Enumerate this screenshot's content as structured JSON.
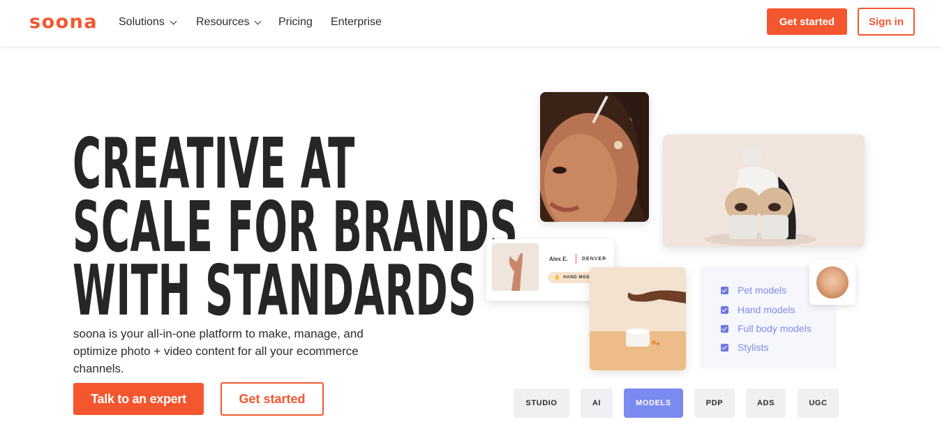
{
  "brand": {
    "logo": "soona",
    "accent": "#f4562f"
  },
  "nav": {
    "items": [
      {
        "label": "Solutions",
        "dropdown": true
      },
      {
        "label": "Resources",
        "dropdown": true
      },
      {
        "label": "Pricing",
        "dropdown": false
      },
      {
        "label": "Enterprise",
        "dropdown": false
      }
    ],
    "get_started": "Get started",
    "sign_in": "Sign in"
  },
  "hero": {
    "headline": [
      "CREATIVE AT",
      "SCALE FOR BRANDS",
      "WITH STANDARDS"
    ],
    "subtext": "soona is your all-in-one platform to make, manage, and optimize photo + video content for all your ecommerce channels.",
    "cta_primary": "Talk to an expert",
    "cta_secondary": "Get started"
  },
  "model_card": {
    "name": "Alex E.",
    "city": "DENVER",
    "tag": "HAND MODEL"
  },
  "models_list": {
    "items": [
      "Pet models",
      "Hand models",
      "Full body models",
      "Stylists"
    ],
    "color": "#7f8ae6"
  },
  "tabs": {
    "items": [
      "STUDIO",
      "AI",
      "MODELS",
      "PDP",
      "ADS",
      "UGC"
    ],
    "active": "MODELS",
    "active_color": "#7b8af0"
  }
}
